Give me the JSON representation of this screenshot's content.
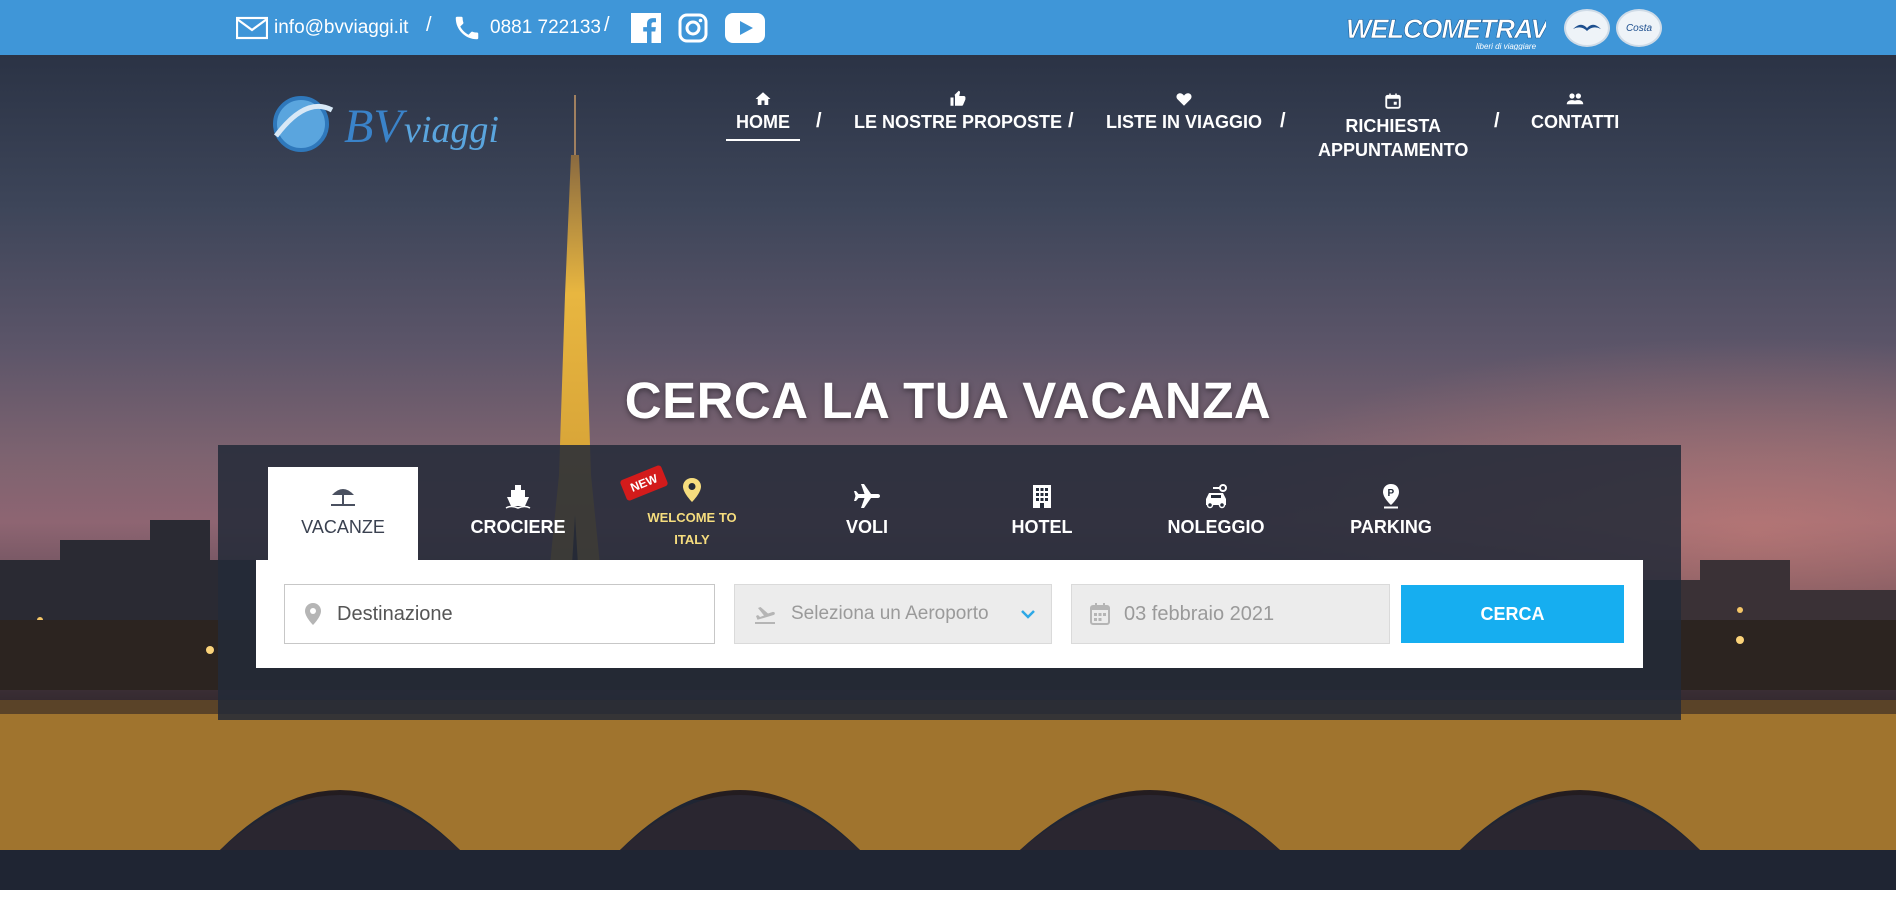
{
  "topbar": {
    "email": "info@bvviaggi.it",
    "phone": "0881 722133",
    "separator": "/",
    "brand": "WELCOMETRAVEL",
    "brand_tagline": "liberi di viaggiare",
    "badge_costa": "Costa"
  },
  "logo": {
    "text_bv": "BV",
    "text_viaggi": "viaggi"
  },
  "nav": [
    {
      "label": "HOME",
      "icon": "home-icon"
    },
    {
      "label": "LE NOSTRE PROPOSTE",
      "icon": "thumbs-up-icon"
    },
    {
      "label": "LISTE IN VIAGGIO",
      "icon": "heart-icon"
    },
    {
      "label_line1": "RICHIESTA",
      "label_line2": "APPUNTAMENTO",
      "icon": "calendar-icon"
    },
    {
      "label": "CONTATTI",
      "icon": "people-icon"
    }
  ],
  "nav_separator": "/",
  "hero": {
    "headline": "CERCA LA TUA VACANZA"
  },
  "tabs": [
    {
      "label": "VACANZE",
      "icon": "beach-umbrella-icon",
      "active": true
    },
    {
      "label": "CROCIERE",
      "icon": "ship-icon"
    },
    {
      "label_line1": "WELCOME TO",
      "label_line2": "ITALY",
      "icon": "map-pin-icon",
      "badge": "NEW"
    },
    {
      "label": "VOLI",
      "icon": "airplane-icon"
    },
    {
      "label": "HOTEL",
      "icon": "building-icon"
    },
    {
      "label": "NOLEGGIO",
      "icon": "car-rental-icon"
    },
    {
      "label": "PARKING",
      "icon": "parking-pin-icon"
    }
  ],
  "search": {
    "destination_placeholder": "Destinazione",
    "airport_placeholder": "Seleziona un Aeroporto",
    "date_value": "03 febbraio 2021",
    "button_label": "CERCA"
  },
  "colors": {
    "topbar": "#3f96d8",
    "button": "#16aef0",
    "panel": "#232a38",
    "badge_new": "#d31b1b",
    "italy_label": "#f6dd7e"
  }
}
